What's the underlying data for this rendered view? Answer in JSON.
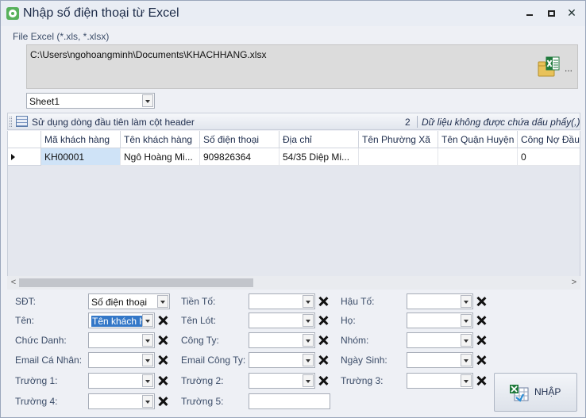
{
  "window": {
    "title": "Nhập số điện thoại từ Excel",
    "minimize_label": "",
    "maximize_label": "",
    "close_label": "✕"
  },
  "file": {
    "label": "File Excel (*.xls, *.xlsx)",
    "path": "C:\\Users\\ngohoangminh\\Documents\\KHACHHANG.xlsx",
    "browse_label": "..."
  },
  "sheet": {
    "selected": "Sheet1"
  },
  "toolbar": {
    "header_option": "Sử dụng dòng đầu tiên làm cột header",
    "count": "2",
    "note": "Dữ liệu không được chứa dấu phẩy(,)"
  },
  "grid": {
    "columns": [
      "Mã khách hàng",
      "Tên khách hàng",
      "Số điện thoại",
      "Địa chỉ",
      "Tên Phường Xã",
      "Tên Quận Huyện",
      "Công Nợ Đầu K"
    ],
    "rows": [
      [
        "KH00001",
        "Ngô Hoàng Mi...",
        "909826364",
        "54/35 Diệp Mi...",
        "",
        "",
        "0"
      ]
    ]
  },
  "mapping": {
    "sdt": {
      "label": "SĐT:",
      "value": "Số điện thoại"
    },
    "ten": {
      "label": "Tên:",
      "value": "Tên khách h"
    },
    "chuc_danh": {
      "label": "Chức Danh:",
      "value": ""
    },
    "email_ca_nhan": {
      "label": "Email Cá Nhân:",
      "value": ""
    },
    "truong1": {
      "label": "Trường 1:",
      "value": ""
    },
    "truong4": {
      "label": "Trường 4:",
      "value": ""
    },
    "tien_to": {
      "label": "Tiền Tố:",
      "value": ""
    },
    "ten_lot": {
      "label": "Tên Lót:",
      "value": ""
    },
    "cong_ty": {
      "label": "Công Ty:",
      "value": ""
    },
    "email_cong_ty": {
      "label": "Email Công Ty:",
      "value": ""
    },
    "truong2": {
      "label": "Trường 2:",
      "value": ""
    },
    "truong5": {
      "label": "Trường 5:",
      "value": ""
    },
    "hau_to": {
      "label": "Hậu Tố:",
      "value": ""
    },
    "ho": {
      "label": "Họ:",
      "value": ""
    },
    "nhom": {
      "label": "Nhóm:",
      "value": ""
    },
    "ngay_sinh": {
      "label": "Ngày Sinh:",
      "value": ""
    },
    "truong3": {
      "label": "Trường 3:",
      "value": ""
    }
  },
  "actions": {
    "import_label": "NHẬP"
  },
  "colors": {
    "selection": "#3478c8",
    "cell_selected": "#cfe3f7",
    "excel_green": "#1f7a3c"
  }
}
